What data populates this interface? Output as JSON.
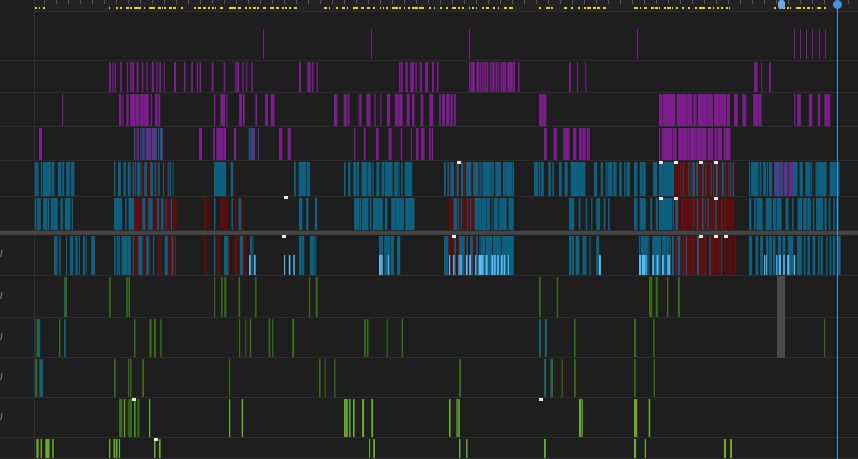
{
  "app": {
    "title": "",
    "colors": {
      "background": "#1e1e1e",
      "ruler_marker": "#e8d21c",
      "playhead": "#4a90e2",
      "purple": "#7a1f8a",
      "teal": "#0f5f7e",
      "dark_red": "#5c0e0e",
      "light_blue": "#5cb8f0",
      "green": "#3a6a1a",
      "bright_green": "#6fae2a",
      "white": "#e8e8e8"
    }
  },
  "lanes": [
    {
      "name": "",
      "kind": "purple-sparse"
    },
    {
      "name": "",
      "kind": "purple"
    },
    {
      "name": "",
      "kind": "purple"
    },
    {
      "name": "",
      "kind": "purple-teal"
    },
    {
      "name": "",
      "kind": "teal"
    },
    {
      "name": "",
      "kind": "teal"
    },
    {
      "name": "l",
      "kind": "teal-lightblue"
    },
    {
      "name": "l",
      "kind": "green"
    },
    {
      "name": "l",
      "kind": "green"
    },
    {
      "name": "l",
      "kind": "green"
    },
    {
      "name": "l",
      "kind": "green"
    },
    {
      "name": "",
      "kind": "bright-green"
    }
  ],
  "icons": {
    "playhead_handle": "circle-handle-icon",
    "range_thumb": "range-thumb-icon"
  }
}
